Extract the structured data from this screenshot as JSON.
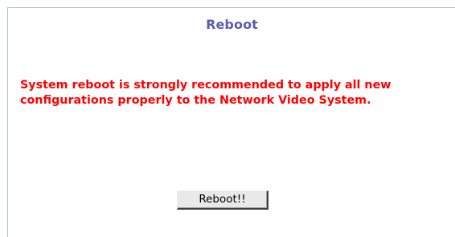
{
  "panel": {
    "title": "Reboot",
    "message_lines": [
      "System reboot is strongly recommended to apply all new",
      "configurations properly to the Network Video System."
    ],
    "reboot_button_label": "Reboot!!"
  },
  "colors": {
    "title": "#5b5bb0",
    "message": "#ff0000",
    "border": "#aebfd3",
    "button_face": "#e9e9e9"
  }
}
